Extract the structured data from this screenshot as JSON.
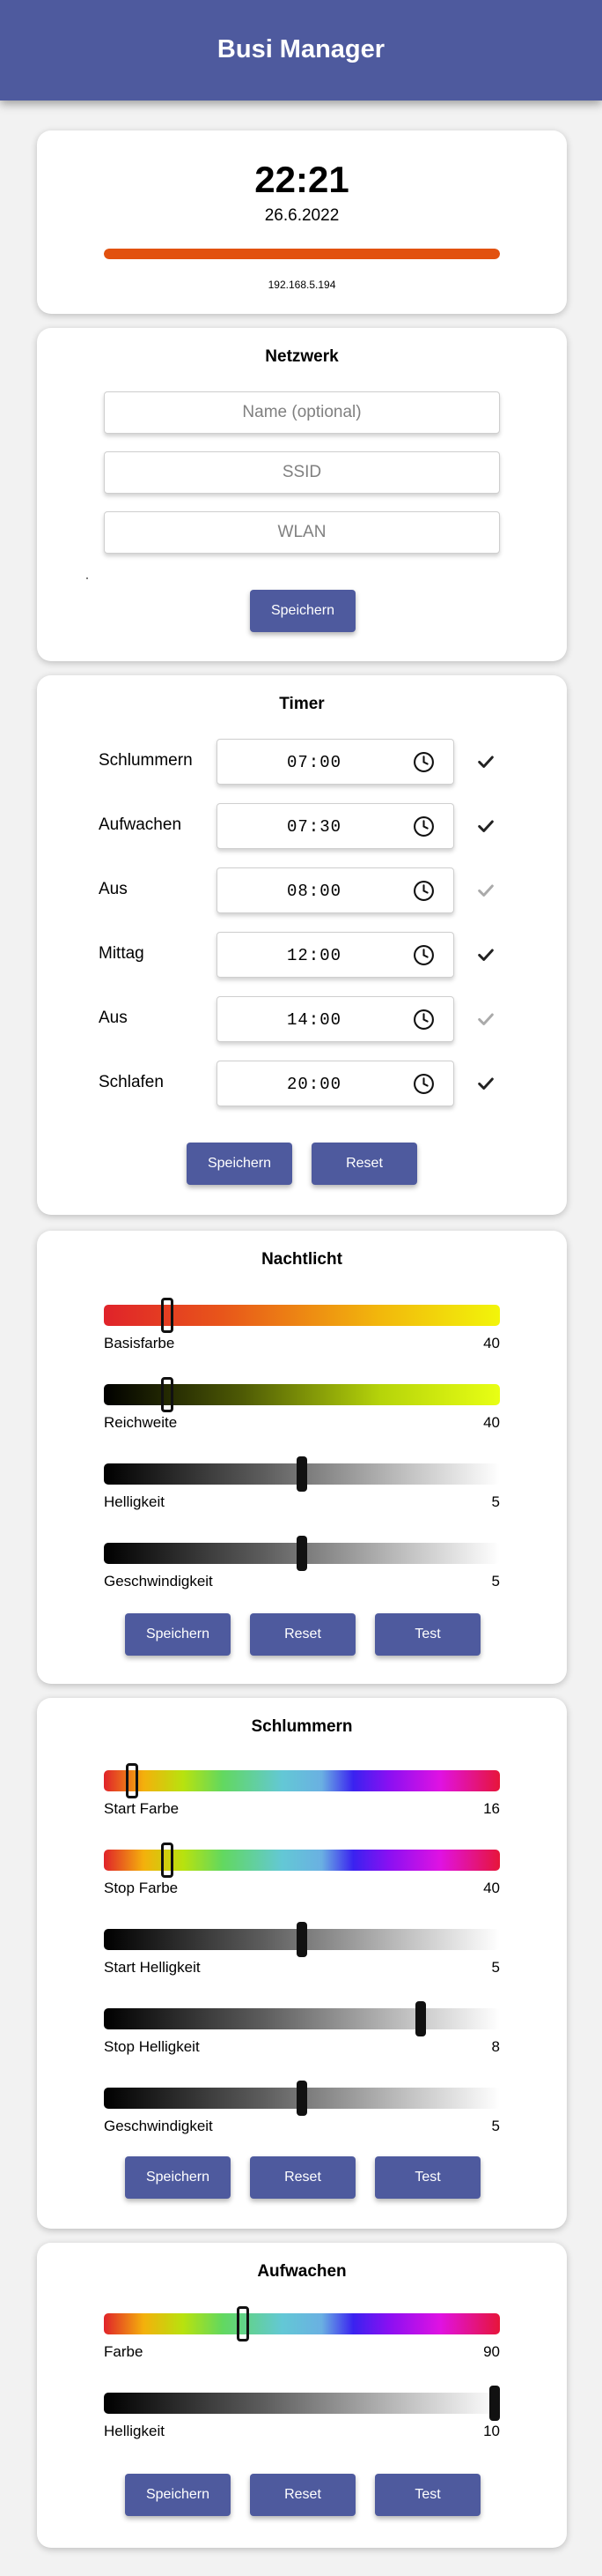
{
  "header": {
    "title": "Busi Manager"
  },
  "status": {
    "time": "22:21",
    "date": "26.6.2022",
    "ip": "192.168.5.194",
    "progress": 1.0,
    "progress_color": "#e2510f"
  },
  "network": {
    "title": "Netzwerk",
    "name_placeholder": "Name (optional)",
    "ssid_placeholder": "SSID",
    "wlan_placeholder": "WLAN",
    "save_label": "Speichern"
  },
  "timer": {
    "title": "Timer",
    "rows": [
      {
        "label": "Schlummern",
        "time": "07:00",
        "checked": true
      },
      {
        "label": "Aufwachen",
        "time": "07:30",
        "checked": true
      },
      {
        "label": "Aus",
        "time": "08:00",
        "checked": false
      },
      {
        "label": "Mittag",
        "time": "12:00",
        "checked": true
      },
      {
        "label": "Aus",
        "time": "14:00",
        "checked": false
      },
      {
        "label": "Schlafen",
        "time": "20:00",
        "checked": true
      }
    ],
    "save_label": "Speichern",
    "reset_label": "Reset"
  },
  "nightlight": {
    "title": "Nachtlicht",
    "sliders": [
      {
        "label": "Basisfarbe",
        "value": "40",
        "position": 0.16
      },
      {
        "label": "Reichweite",
        "value": "40",
        "position": 0.16
      },
      {
        "label": "Helligkeit",
        "value": "5",
        "position": 0.5
      },
      {
        "label": "Geschwindigkeit",
        "value": "5",
        "position": 0.5
      }
    ],
    "save_label": "Speichern",
    "reset_label": "Reset",
    "test_label": "Test"
  },
  "snooze": {
    "title": "Schlummern",
    "sliders": [
      {
        "label": "Start Farbe",
        "value": "16",
        "position": 0.07
      },
      {
        "label": "Stop Farbe",
        "value": "40",
        "position": 0.16
      },
      {
        "label": "Start Helligkeit",
        "value": "5",
        "position": 0.5
      },
      {
        "label": "Stop Helligkeit",
        "value": "8",
        "position": 0.8
      },
      {
        "label": "Geschwindigkeit",
        "value": "5",
        "position": 0.5
      }
    ],
    "save_label": "Speichern",
    "reset_label": "Reset",
    "test_label": "Test"
  },
  "wakeup": {
    "title": "Aufwachen",
    "sliders": [
      {
        "label": "Farbe",
        "value": "90",
        "position": 0.35
      },
      {
        "label": "Helligkeit",
        "value": "10",
        "position": 1.0
      }
    ],
    "save_label": "Speichern",
    "reset_label": "Reset",
    "test_label": "Test"
  },
  "colors": {
    "accent": "#4e5a9e",
    "check_on": "#222222",
    "check_off": "#aaaaaa"
  }
}
